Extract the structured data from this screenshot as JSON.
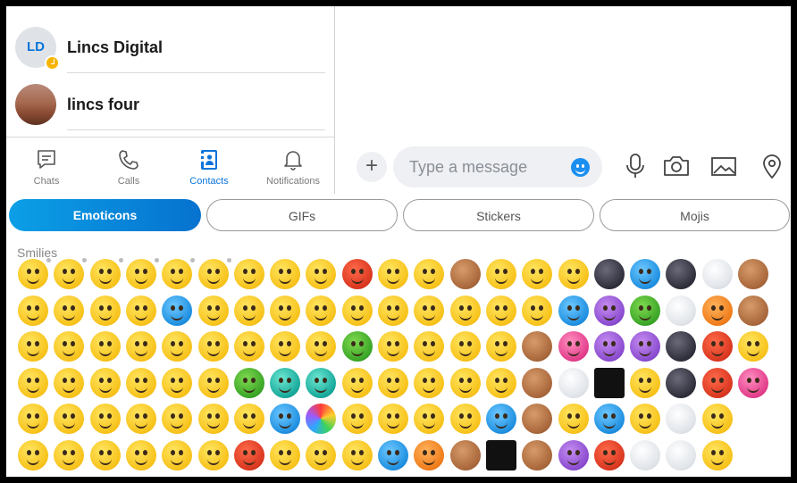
{
  "contacts": [
    {
      "name": "Lincs Digital",
      "initials": "LD",
      "status": "away"
    },
    {
      "name": "lincs four",
      "initials": ""
    }
  ],
  "nav": [
    {
      "label": "Chats",
      "icon": "chat-icon",
      "active": false
    },
    {
      "label": "Calls",
      "icon": "phone-icon",
      "active": false
    },
    {
      "label": "Contacts",
      "icon": "contacts-icon",
      "active": true
    },
    {
      "label": "Notifications",
      "icon": "bell-icon",
      "active": false
    }
  ],
  "composer": {
    "placeholder": "Type a message",
    "tools": [
      "microphone-icon",
      "camera-icon",
      "image-icon",
      "location-icon"
    ]
  },
  "tabs": [
    {
      "label": "Emoticons",
      "active": true
    },
    {
      "label": "GIFs",
      "active": false
    },
    {
      "label": "Stickers",
      "active": false
    },
    {
      "label": "Mojis",
      "active": false
    }
  ],
  "section": {
    "title": "Smilies"
  },
  "colors": {
    "accent": "#0b74d9",
    "tab_gradient_start": "#0b9fe6",
    "tab_gradient_end": "#0672cf"
  },
  "emoticons": [
    [
      "yellow",
      "yellow",
      "yellow",
      "yellow",
      "yellow",
      "yellow",
      "yellow",
      "yellow",
      "yellow",
      "red",
      "yellow",
      "yellow",
      "brown",
      "yellow",
      "yellow",
      "yellow",
      "dark",
      "blue",
      "dark",
      "white",
      "brown"
    ],
    [
      "yellow",
      "yellow",
      "yellow",
      "yellow",
      "blue",
      "yellow",
      "yellow",
      "yellow",
      "yellow",
      "yellow",
      "yellow",
      "yellow",
      "yellow",
      "yellow",
      "yellow",
      "blue",
      "purple",
      "green",
      "white",
      "orange",
      "brown"
    ],
    [
      "yellow",
      "yellow",
      "yellow",
      "yellow",
      "yellow",
      "yellow",
      "yellow",
      "yellow",
      "yellow",
      "green",
      "yellow",
      "yellow",
      "yellow",
      "yellow",
      "brown",
      "pink",
      "purple",
      "purple",
      "dark",
      "red",
      "yellow"
    ],
    [
      "yellow",
      "yellow",
      "yellow",
      "yellow",
      "yellow",
      "yellow",
      "green",
      "teal",
      "teal",
      "yellow",
      "yellow",
      "yellow",
      "yellow",
      "yellow",
      "brown",
      "white",
      "black",
      "yellow",
      "dark",
      "red",
      "pink"
    ],
    [
      "yellow",
      "yellow",
      "yellow",
      "yellow",
      "yellow",
      "yellow",
      "yellow",
      "blue",
      "rainbow",
      "yellow",
      "yellow",
      "yellow",
      "yellow",
      "blue",
      "brown",
      "yellow",
      "blue",
      "yellow",
      "white",
      "yellow"
    ],
    [
      "yellow",
      "yellow",
      "yellow",
      "yellow",
      "yellow",
      "yellow",
      "red",
      "yellow",
      "yellow",
      "yellow",
      "blue",
      "orange",
      "brown",
      "black",
      "brown",
      "purple",
      "red",
      "white",
      "white",
      "yellow"
    ]
  ]
}
